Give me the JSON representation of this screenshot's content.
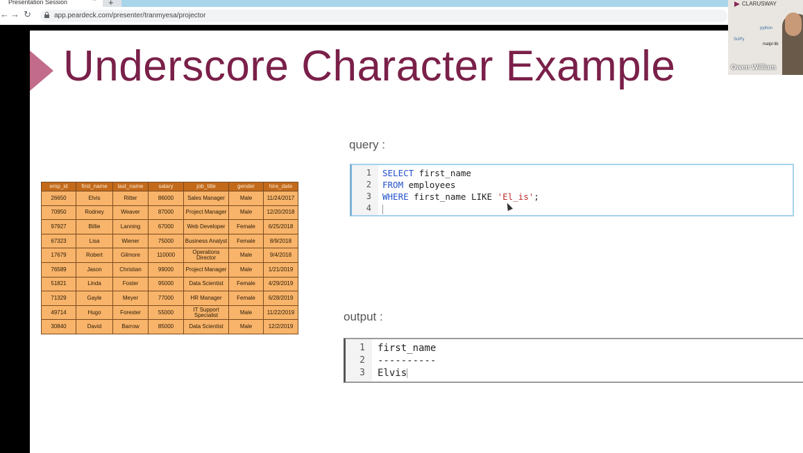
{
  "browser": {
    "tab_title": "Presentation Session",
    "tab_close": "×",
    "new_tab": "+",
    "back": "←",
    "forward": "→",
    "reload": "↻",
    "url": "app.peardeck.com/presenter/tranmyesa/projector"
  },
  "slide": {
    "title": "Underscore Character Example",
    "query_label": "query :",
    "output_label": "output :"
  },
  "employees": {
    "headers": [
      "emp_id",
      "first_name",
      "last_name",
      "salary",
      "job_title",
      "gender",
      "hire_date"
    ],
    "rows": [
      [
        "26650",
        "Elvis",
        "Ritter",
        "86000",
        "Sales Manager",
        "Male",
        "11/24/2017"
      ],
      [
        "70950",
        "Rodney",
        "Weaver",
        "87000",
        "Project Manager",
        "Male",
        "12/20/2018"
      ],
      [
        "97927",
        "Billie",
        "Lanning",
        "67000",
        "Web Developer",
        "Female",
        "6/25/2018"
      ],
      [
        "67323",
        "Lisa",
        "Wiener",
        "75000",
        "Business Analyst",
        "Female",
        "8/9/2018"
      ],
      [
        "17679",
        "Robert",
        "Gilmore",
        "110000",
        "Operations Director",
        "Male",
        "9/4/2018"
      ],
      [
        "76589",
        "Jason",
        "Christian",
        "99000",
        "Project Manager",
        "Male",
        "1/21/2019"
      ],
      [
        "51821",
        "Linda",
        "Foster",
        "95000",
        "Data Scientist",
        "Female",
        "4/29/2019"
      ],
      [
        "71329",
        "Gayle",
        "Meyer",
        "77000",
        "HR Manager",
        "Female",
        "6/28/2019"
      ],
      [
        "49714",
        "Hugo",
        "Forester",
        "55000",
        "IT Support Specialist",
        "Male",
        "11/22/2019"
      ],
      [
        "30840",
        "David",
        "Barrow",
        "85000",
        "Data Scientist",
        "Male",
        "12/2/2019"
      ]
    ]
  },
  "query": {
    "line_numbers": [
      "1",
      "2",
      "3",
      "4"
    ],
    "l1_kw": "SELECT",
    "l1_rest": " first_name",
    "l2_kw": "FROM",
    "l2_rest": " employees",
    "l3_kw": "WHERE",
    "l3_mid": " first_name LIKE ",
    "l3_str": "'El_is'",
    "l3_end": ";"
  },
  "output": {
    "line_numbers": [
      "1",
      "2",
      "3"
    ],
    "lines": [
      "first_name",
      "----------",
      "Elvis"
    ]
  },
  "webcam": {
    "brand": "CLARUSWAY",
    "items": [
      "python",
      "SciPy",
      "matpl⋅lib"
    ],
    "participant_name": "Owen William"
  },
  "colors": {
    "title": "#7a2049",
    "accent_marker": "#c26b8a",
    "table_header": "#c36a1a",
    "table_cell": "#f8b46a",
    "sql_keyword": "#2350c9",
    "sql_string": "#c02b2b"
  }
}
